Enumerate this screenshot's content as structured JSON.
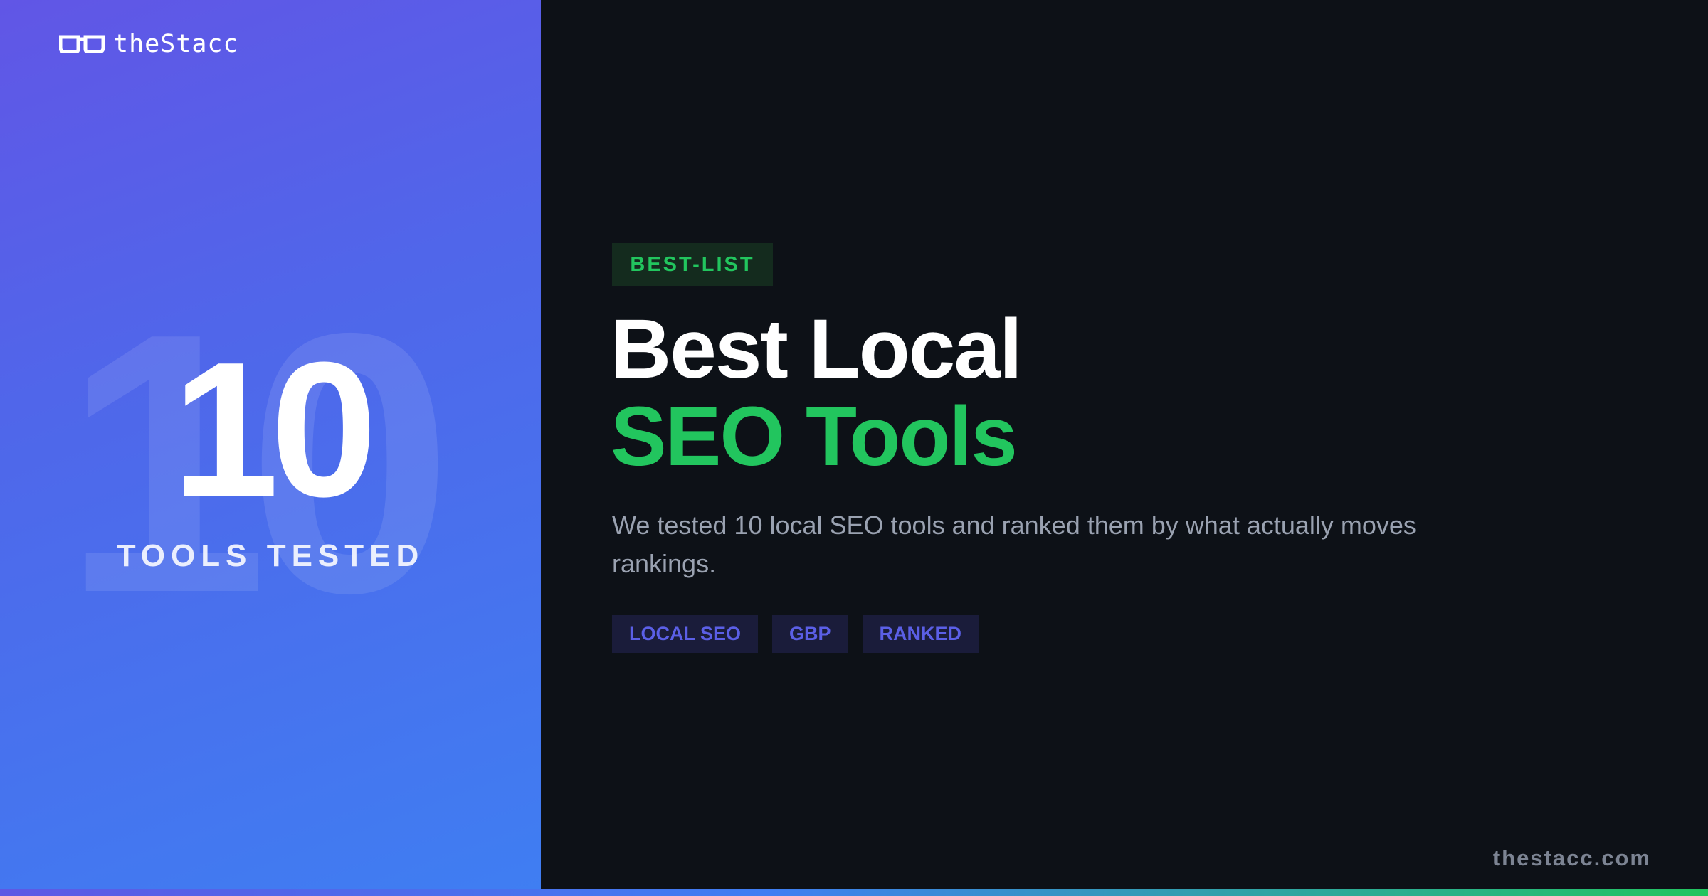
{
  "logo": {
    "text": "theStacc",
    "icon": "glasses-icon"
  },
  "hero": {
    "number": "10",
    "bg_number": "10",
    "label": "TOOLS TESTED"
  },
  "badge": "BEST-LIST",
  "title": {
    "line1": "Best Local",
    "line2": "SEO Tools"
  },
  "subtitle": "We tested 10 local SEO tools and ranked them by what actually moves rankings.",
  "tags": [
    "LOCAL SEO",
    "GBP",
    "RANKED"
  ],
  "footer": {
    "url": "thestacc.com"
  },
  "colors": {
    "accent_green": "#22c55e",
    "accent_purple": "#5b5fe6",
    "background": "#0d1117",
    "left_gradient_start": "#6156e6",
    "left_gradient_end": "#3f7ef2"
  }
}
